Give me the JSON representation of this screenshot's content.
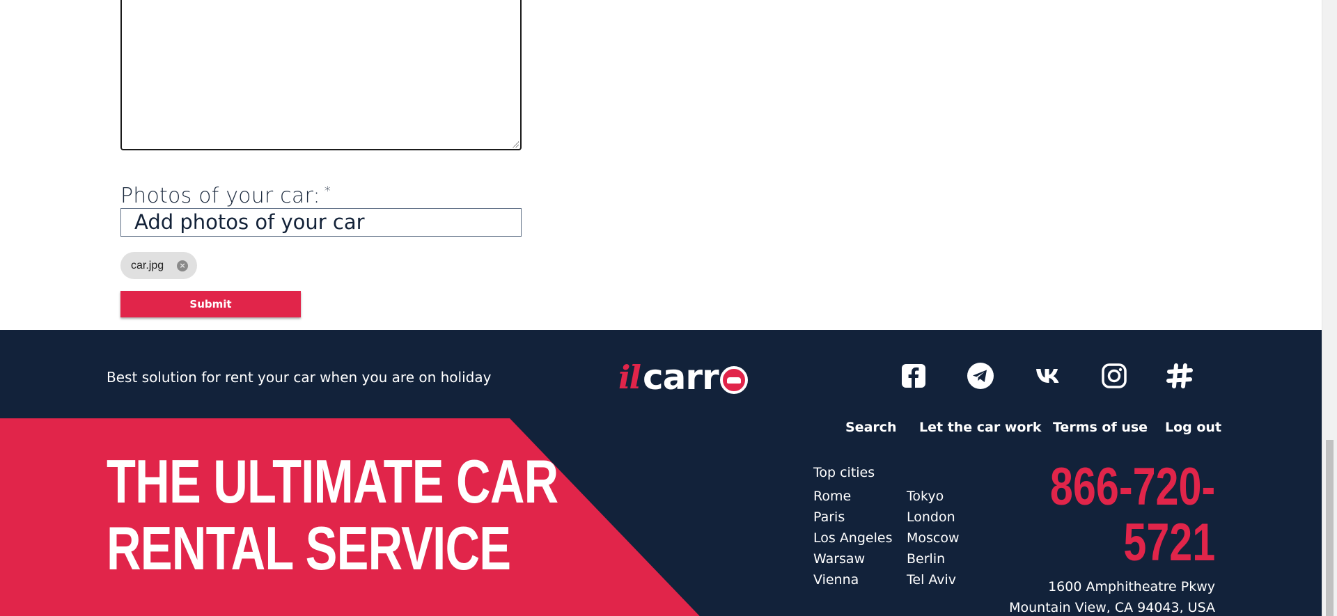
{
  "form": {
    "photos_label": "Photos of your car:",
    "required_mark": "*",
    "photos_placeholder": "Add photos of your car",
    "attached_file": "car.jpg",
    "submit_label": "Submit"
  },
  "footer": {
    "tagline": "Best solution for rent your car when you are on holiday",
    "logo": {
      "prefix": "il",
      "word": "carr"
    },
    "social_icons": [
      "facebook-icon",
      "telegram-icon",
      "vk-icon",
      "instagram-icon",
      "slack-icon"
    ],
    "nav": [
      "Search",
      "Let the car work",
      "Terms of use",
      "Log out"
    ],
    "headline": [
      "THE ULTIMATE CAR",
      "RENTAL SERVICE"
    ],
    "cities_title": "Top cities",
    "cities_left": [
      "Rome",
      "Paris",
      "Los Angeles",
      "Warsaw",
      "Vienna"
    ],
    "cities_right": [
      "Tokyo",
      "London",
      "Moscow",
      "Berlin",
      "Tel Aviv"
    ],
    "phone": [
      "866-720-",
      "5721"
    ],
    "address": [
      "1600 Amphitheatre Pkwy",
      "Mountain View, CA 94043, USA"
    ]
  },
  "colors": {
    "accent": "#e1254a",
    "footer_bg": "#12223a",
    "text_dark": "#1c2a3e"
  }
}
